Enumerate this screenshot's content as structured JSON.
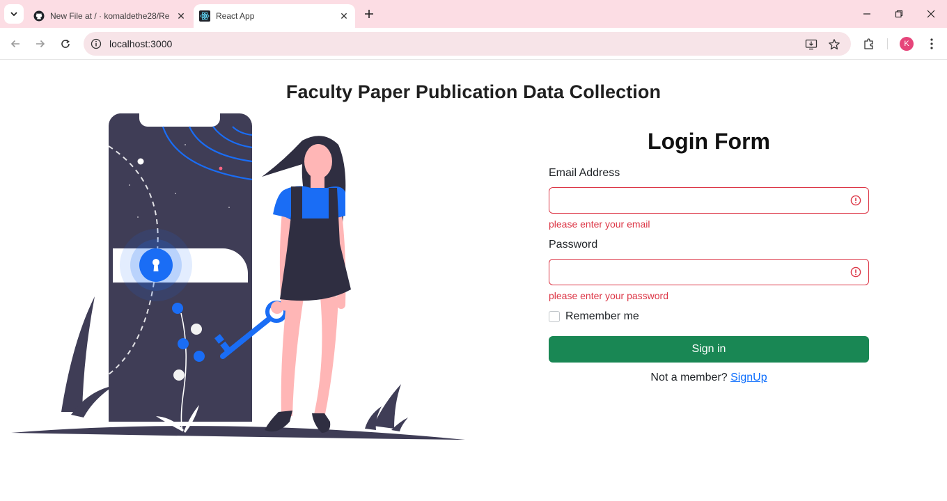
{
  "browser": {
    "tabs": [
      {
        "title": "New File at / · komaldethe28/Re",
        "active": false
      },
      {
        "title": "React App",
        "active": true
      }
    ],
    "url": "localhost:3000",
    "profile_initial": "K"
  },
  "page": {
    "title": "Faculty Paper Publication Data Collection"
  },
  "login": {
    "title": "Login Form",
    "email_label": "Email Address",
    "email_value": "",
    "email_error": "please enter your email",
    "password_label": "Password",
    "password_value": "",
    "password_error": "please enter your password",
    "remember_label": "Remember me",
    "signin_label": "Sign in",
    "footer_text": "Not a member?",
    "signup_link": "SignUp"
  },
  "colors": {
    "accent": "#198754",
    "error": "#dc3545",
    "link": "#0d6efd",
    "illustration_blue": "#1a6df5",
    "illustration_dark": "#3f3d56",
    "tabstrip": "#fcdde4"
  }
}
